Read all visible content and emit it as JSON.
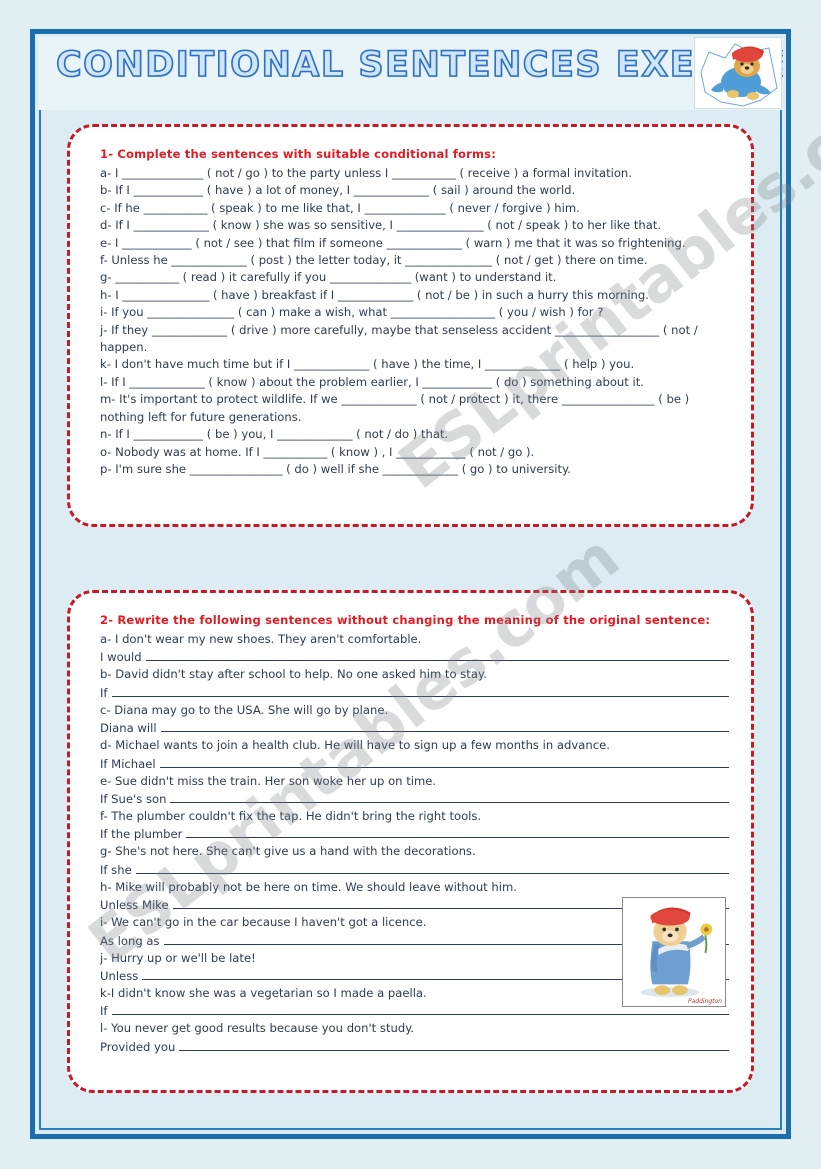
{
  "page": {
    "title": "CONDITIONAL SENTENCES EXERCISES",
    "background_color": "#e2f0f4",
    "frame_color": "#1b6fad",
    "heading_color": "#e11b24",
    "text_color": "#2c3d52",
    "dashed_border_color": "#c51a28",
    "watermark": "ESLprintables.com"
  },
  "images": {
    "top_right": {
      "name": "paddington-bear-jumping",
      "description": "Paddington bear in red hat and blue coat bursting through paper"
    },
    "bottom_right": {
      "name": "paddington-bear-flower",
      "description": "Paddington bear in red hat and blue coat holding a yellow flower",
      "caption": "Paddington"
    }
  },
  "exercise1": {
    "heading": "1- Complete the sentences with suitable conditional forms:",
    "items": [
      "a- I ______________ ( not / go ) to the party unless I ___________ ( receive ) a formal invitation.",
      "b- If I ____________ ( have ) a lot of money, I _____________ ( sail ) around the world.",
      "c- If he ___________ ( speak ) to me like that, I ______________ ( never / forgive ) him.",
      "d- If I _____________ ( know ) she was so sensitive, I _______________ ( not / speak ) to her like that.",
      "e- I ____________ ( not / see ) that film if someone _____________ ( warn ) me that it was so frightening.",
      "f- Unless he _____________ ( post ) the letter today, it _______________ ( not / get ) there on time.",
      "g- ___________ ( read ) it carefully if you ______________ (want ) to understand it.",
      "h- I _______________ ( have ) breakfast if I _____________ ( not / be ) in such a hurry this morning.",
      "i- If you _______________ ( can ) make a wish, what __________________ ( you / wish ) for ?",
      "j- If they _____________ ( drive ) more carefully, maybe that senseless accident __________________ ( not / happen.",
      "k- I don't have much time but if I _____________ ( have ) the time, I _____________ ( help ) you.",
      "l- If I _____________ ( know ) about the problem earlier, I ____________ ( do ) something about it.",
      "m- It's important to protect wildlife. If we _____________ ( not / protect ) it, there ________________ ( be ) nothing left for future generations.",
      "n- If I ____________ ( be ) you, I _____________ ( not / do ) that.",
      "o- Nobody was at home. If I ___________ ( know ) , I ____________ ( not / go ).",
      "p- I'm sure she ________________ ( do ) well if she _____________ ( go ) to university."
    ]
  },
  "exercise2": {
    "heading": "2-  Rewrite the following sentences without changing the meaning of the original sentence:",
    "items": [
      {
        "prompt": "a- I don't wear my new shoes. They aren't comfortable.",
        "stem": "I would"
      },
      {
        "prompt": "b- David didn't stay after school to help. No one asked him to stay.",
        "stem": "If"
      },
      {
        "prompt": "c- Diana may go to the USA. She will go by plane.",
        "stem": "Diana will"
      },
      {
        "prompt": "d- Michael wants to join a health club. He will have to sign up a few months in advance.",
        "stem": "If Michael"
      },
      {
        "prompt": "e- Sue didn't miss the train. Her son woke her up on time.",
        "stem": "If Sue's son"
      },
      {
        "prompt": "f- The plumber couldn't fix the tap. He didn't bring the right tools.",
        "stem": "If the plumber"
      },
      {
        "prompt": "g- She's not here. She can't give us a hand with the decorations.",
        "stem": "If she"
      },
      {
        "prompt": "h- Mike will probably not be here on time. We should leave without him.",
        "stem": "Unless Mike"
      },
      {
        "prompt": "i- We can't go in the car because I haven't got a licence.",
        "stem": "As long as"
      },
      {
        "prompt": "j- Hurry up or we'll be late!",
        "stem": "Unless"
      },
      {
        "prompt": "k-I didn't know she was a vegetarian so I made a paella.",
        "stem": "If"
      },
      {
        "prompt": "l- You never get good results because you don't study.",
        "stem": "Provided you"
      }
    ]
  }
}
